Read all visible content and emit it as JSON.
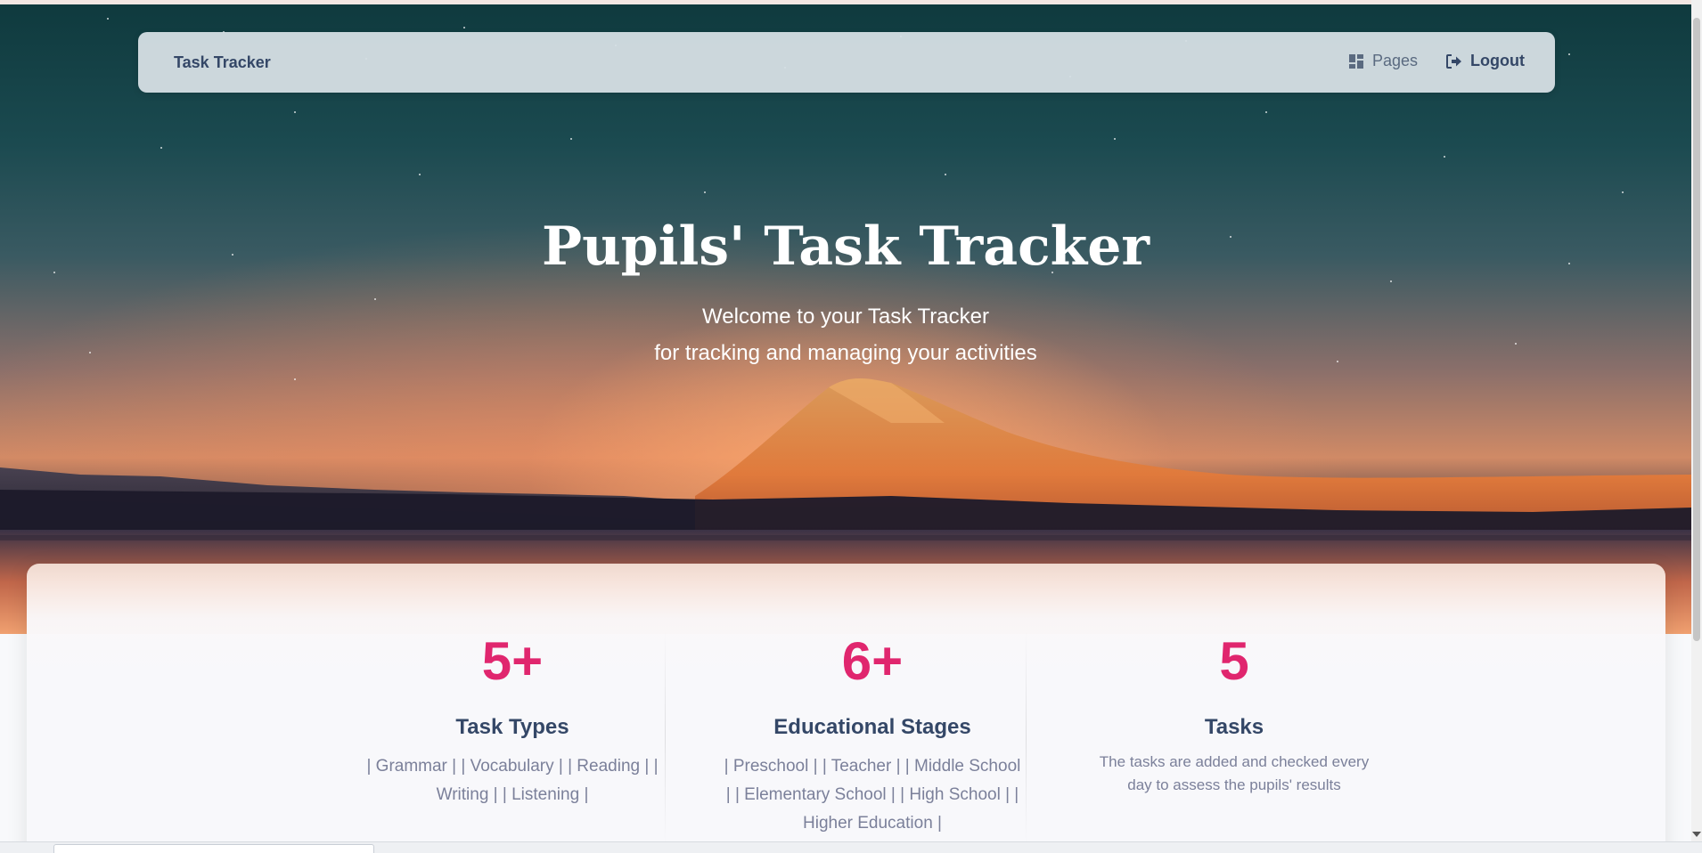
{
  "navbar": {
    "brand": "Task Tracker",
    "pages_label": "Pages",
    "logout_label": "Logout"
  },
  "hero": {
    "title": "Pupils' Task Tracker",
    "subtitle_line1": "Welcome to your Task Tracker",
    "subtitle_line2": "for tracking and managing your activities"
  },
  "stats": [
    {
      "number": "5+",
      "heading": "Task Types",
      "description": "| Grammar | | Vocabulary | | Reading | | Writing | | Listening |"
    },
    {
      "number": "6+",
      "heading": "Educational Stages",
      "description": "| Preschool | | Teacher | | Middle School | | Elementary School | | High School | | Higher Education |"
    },
    {
      "number": "5",
      "heading": "Tasks",
      "description": "The tasks are added and checked every day to assess the pupils' results"
    }
  ],
  "colors": {
    "accent": "#e0266e",
    "heading": "#344767",
    "muted": "#7b809a",
    "navbar_bg": "#d6dfe5"
  },
  "icons": {
    "pages": "dashboard-grid-icon",
    "logout": "sign-out-icon"
  }
}
